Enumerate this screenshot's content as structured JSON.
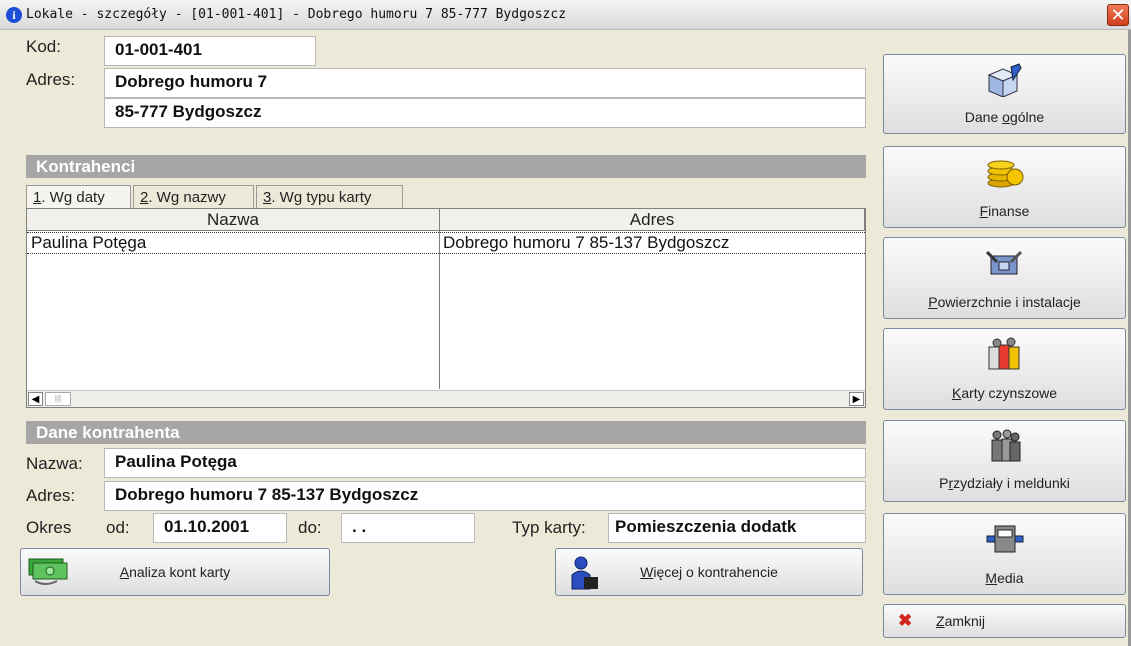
{
  "window": {
    "title": "Lokale - szczegóły - [01-001-401] - Dobrego humoru 7 85-777 Bydgoszcz"
  },
  "header": {
    "kod_label": "Kod:",
    "kod_value": "01-001-401",
    "adres_label": "Adres:",
    "adres_line1": "Dobrego humoru 7",
    "adres_line2": "85-777 Bydgoszcz"
  },
  "kontrahenci": {
    "section_title": "Kontrahenci",
    "tabs": [
      {
        "num": "1",
        "label": ". Wg daty"
      },
      {
        "num": "2",
        "label": ". Wg nazwy"
      },
      {
        "num": "3",
        "label": ". Wg typu karty"
      }
    ],
    "columns": [
      "Nazwa",
      "Adres"
    ],
    "rows": [
      {
        "nazwa": "Paulina Potęga",
        "adres": "Dobrego humoru 7 85-137 Bydgoszcz"
      }
    ]
  },
  "dane_kontrahenta": {
    "section_title": "Dane kontrahenta",
    "nazwa_label": "Nazwa:",
    "nazwa_value": "Paulina Potęga",
    "adres_label": "Adres:",
    "adres_value": "Dobrego humoru 7 85-137 Bydgoszcz",
    "okres_label": "Okres",
    "od_label": "od:",
    "od_value": "01.10.2001",
    "do_label": "do:",
    "do_value": ". .",
    "typ_label": "Typ karty:",
    "typ_value": "Pomieszczenia dodatk"
  },
  "bottom_buttons": {
    "analiza": {
      "pre": "",
      "u": "A",
      "post": "naliza kont karty"
    },
    "wiecej": {
      "pre": "",
      "u": "W",
      "post": "ięcej o kontrahencie"
    }
  },
  "side_buttons": [
    {
      "pre": "Dane ",
      "u": "o",
      "post": "gólne",
      "icon": "notebook-pen-icon"
    },
    {
      "pre": "",
      "u": "F",
      "post": "inanse",
      "icon": "coins-icon"
    },
    {
      "pre": "",
      "u": "P",
      "post": "owierzchnie i instalacje",
      "icon": "tools-icon"
    },
    {
      "pre": "",
      "u": "K",
      "post": "arty czynszowe",
      "icon": "cards-icon"
    },
    {
      "pre": "P",
      "u": "r",
      "post": "zydziały i meldunki",
      "icon": "people-icon"
    },
    {
      "pre": "",
      "u": "M",
      "post": "edia",
      "icon": "meter-icon"
    },
    {
      "pre": "",
      "u": "Z",
      "post": "amknij",
      "icon": "close-x-icon"
    }
  ],
  "colors": {
    "background": "#ECE9D8",
    "section": "#A6A6A6",
    "accent_close": "#D03E1D"
  }
}
